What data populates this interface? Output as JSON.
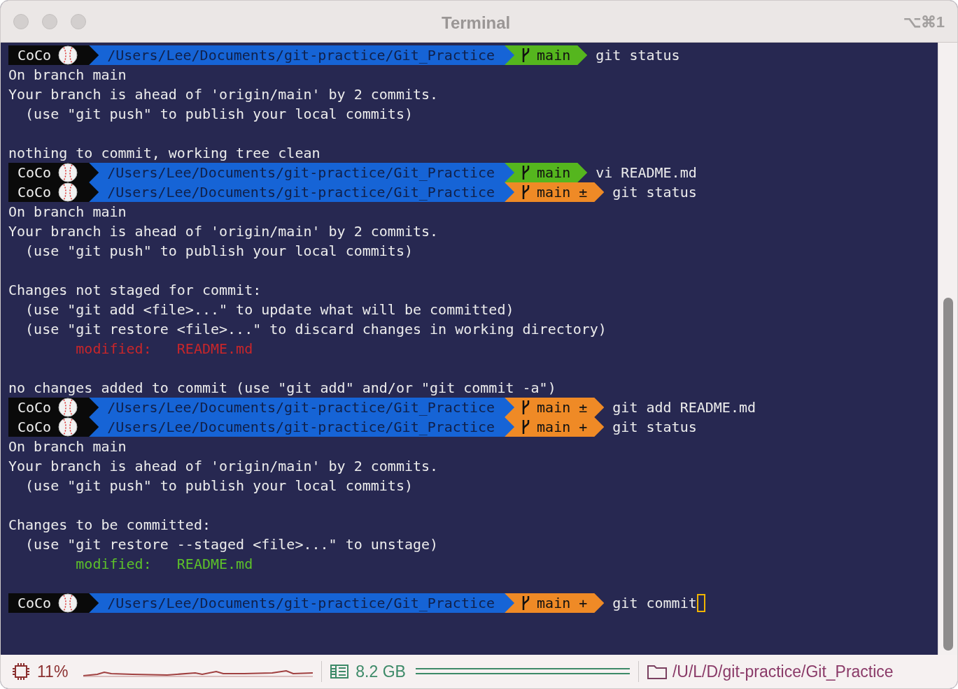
{
  "window": {
    "title": "Terminal",
    "shortcut": "⌥⌘1"
  },
  "lines": [
    {
      "kind": "prompt",
      "user": "CoCo",
      "path": "/Users/Lee/Documents/git-practice/Git_Practice",
      "branch": "main",
      "dirty": false,
      "command": "git status",
      "cursor": false
    },
    {
      "kind": "output",
      "text": "On branch main"
    },
    {
      "kind": "output",
      "text": "Your branch is ahead of 'origin/main' by 2 commits."
    },
    {
      "kind": "output",
      "text": "  (use \"git push\" to publish your local commits)"
    },
    {
      "kind": "blank"
    },
    {
      "kind": "output",
      "text": "nothing to commit, working tree clean"
    },
    {
      "kind": "prompt",
      "user": "CoCo",
      "path": "/Users/Lee/Documents/git-practice/Git_Practice",
      "branch": "main",
      "dirty": false,
      "command": "vi README.md",
      "cursor": false
    },
    {
      "kind": "prompt",
      "user": "CoCo",
      "path": "/Users/Lee/Documents/git-practice/Git_Practice",
      "branch": "main",
      "marker": "±",
      "dirty": true,
      "command": "git status",
      "cursor": false
    },
    {
      "kind": "output",
      "text": "On branch main"
    },
    {
      "kind": "output",
      "text": "Your branch is ahead of 'origin/main' by 2 commits."
    },
    {
      "kind": "output",
      "text": "  (use \"git push\" to publish your local commits)"
    },
    {
      "kind": "blank"
    },
    {
      "kind": "output",
      "text": "Changes not staged for commit:"
    },
    {
      "kind": "output",
      "text": "  (use \"git add <file>...\" to update what will be committed)"
    },
    {
      "kind": "output",
      "text": "  (use \"git restore <file>...\" to discard changes in working directory)"
    },
    {
      "kind": "output",
      "text": "        modified:   README.md",
      "color": "#c8262a"
    },
    {
      "kind": "blank"
    },
    {
      "kind": "output",
      "text": "no changes added to commit (use \"git add\" and/or \"git commit -a\")"
    },
    {
      "kind": "prompt",
      "user": "CoCo",
      "path": "/Users/Lee/Documents/git-practice/Git_Practice",
      "branch": "main",
      "marker": "±",
      "dirty": true,
      "command": "git add README.md",
      "cursor": false
    },
    {
      "kind": "prompt",
      "user": "CoCo",
      "path": "/Users/Lee/Documents/git-practice/Git_Practice",
      "branch": "main",
      "marker": "+",
      "dirty": true,
      "command": "git status",
      "cursor": false
    },
    {
      "kind": "output",
      "text": "On branch main"
    },
    {
      "kind": "output",
      "text": "Your branch is ahead of 'origin/main' by 2 commits."
    },
    {
      "kind": "output",
      "text": "  (use \"git push\" to publish your local commits)"
    },
    {
      "kind": "blank"
    },
    {
      "kind": "output",
      "text": "Changes to be committed:"
    },
    {
      "kind": "output",
      "text": "  (use \"git restore --staged <file>...\" to unstage)"
    },
    {
      "kind": "output",
      "text": "        modified:   README.md",
      "color": "#5cc02a"
    },
    {
      "kind": "blank"
    },
    {
      "kind": "prompt",
      "user": "CoCo",
      "path": "/Users/Lee/Documents/git-practice/Git_Practice",
      "branch": "main",
      "marker": "+",
      "dirty": true,
      "command": "git commit",
      "cursor": true
    }
  ],
  "status_bar": {
    "cpu": "11%",
    "memory": "8.2 GB",
    "path": "/U/L/D/git-practice/Git_Practice"
  }
}
